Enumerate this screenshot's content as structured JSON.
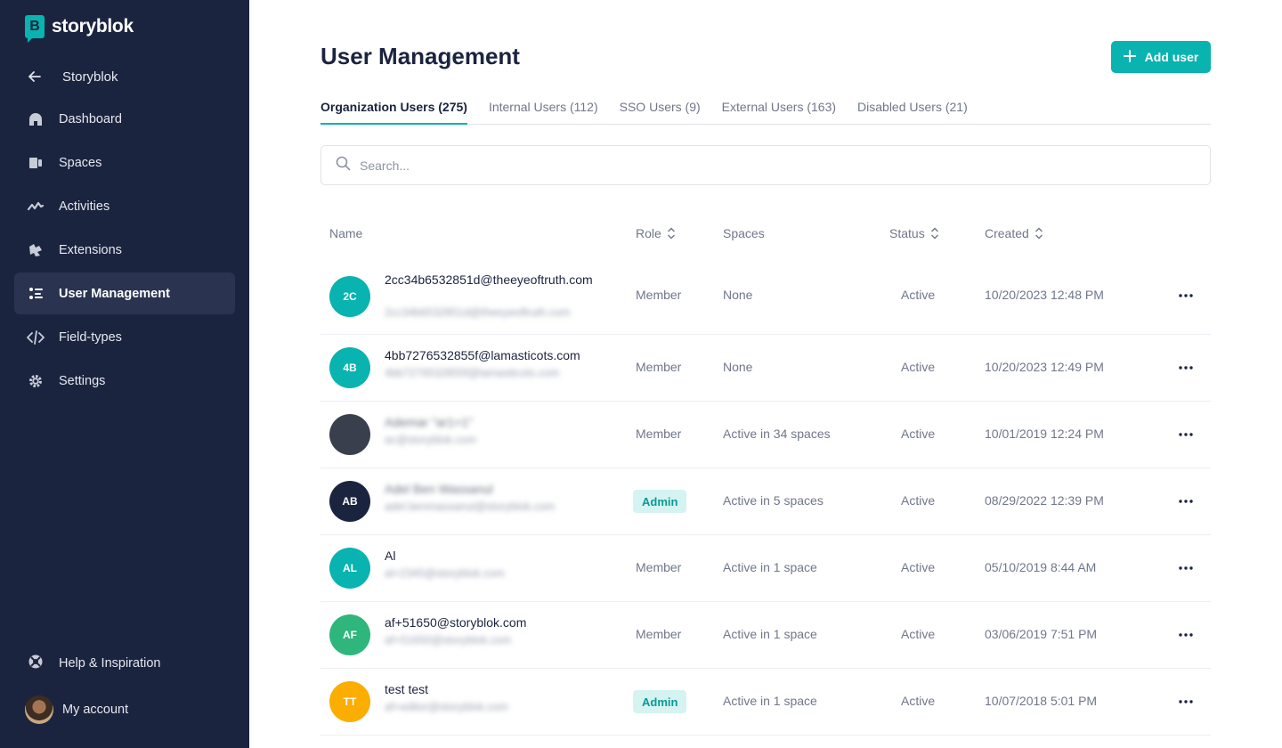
{
  "brand": {
    "name": "storyblok",
    "mark_letter": "B",
    "accent": "#09b3af",
    "sidebar_bg": "#1b243f"
  },
  "sidebar": {
    "back_label": "Storyblok",
    "items": [
      {
        "label": "Dashboard",
        "icon": "dashboard-icon"
      },
      {
        "label": "Spaces",
        "icon": "spaces-icon"
      },
      {
        "label": "Activities",
        "icon": "activities-icon"
      },
      {
        "label": "Extensions",
        "icon": "extensions-icon"
      },
      {
        "label": "User Management",
        "icon": "user-management-icon",
        "active": true
      },
      {
        "label": "Field-types",
        "icon": "code-icon"
      },
      {
        "label": "Settings",
        "icon": "gear-icon"
      }
    ],
    "help_label": "Help & Inspiration",
    "account_label": "My account"
  },
  "page": {
    "title": "User Management",
    "add_button": "Add user",
    "tabs": [
      {
        "label": "Organization Users (275)",
        "active": true
      },
      {
        "label": "Internal Users (112)"
      },
      {
        "label": "SSO Users (9)"
      },
      {
        "label": "External Users (163)"
      },
      {
        "label": "Disabled Users (21)"
      }
    ],
    "search_placeholder": "Search..."
  },
  "table": {
    "columns": {
      "name": "Name",
      "role": "Role",
      "spaces": "Spaces",
      "status": "Status",
      "created": "Created"
    },
    "rows": [
      {
        "initials": "2C",
        "avatar_color": "#09b3af",
        "name": "2cc34b6532851d@theeyeoftruth.com",
        "sub": "2cc34b6532851d@theeyeoftruth.com",
        "role": "Member",
        "spaces": "None",
        "status": "Active",
        "created": "10/20/2023 12:48 PM"
      },
      {
        "initials": "4B",
        "avatar_color": "#09b3af",
        "name": "4bb7276532855f@lamasticots.com",
        "sub": "4bb7276532855f@lamasticots.com",
        "role": "Member",
        "spaces": "None",
        "status": "Active",
        "created": "10/20/2023 12:49 PM"
      },
      {
        "initials": "",
        "avatar_color": "#3a3f4e",
        "name": "Ademar \"ar1+1\"",
        "sub": "ac@storyblok.com",
        "role": "Member",
        "spaces": "Active in 34 spaces",
        "status": "Active",
        "created": "10/01/2019 12:24 PM"
      },
      {
        "initials": "AB",
        "avatar_color": "#1b243f",
        "name": "Adel Ben Wassanul",
        "sub": "adel.benmassanul@storyblok.com",
        "role": "Admin",
        "spaces": "Active in 5 spaces",
        "status": "Active",
        "created": "08/29/2022 12:39 PM"
      },
      {
        "initials": "AL",
        "avatar_color": "#09b3af",
        "name": "Al",
        "sub": "al+2345@storyblok.com",
        "role": "Member",
        "spaces": "Active in 1 space",
        "status": "Active",
        "created": "05/10/2019 8:44 AM"
      },
      {
        "initials": "AF",
        "avatar_color": "#2fb67c",
        "name": "af+51650@storyblok.com",
        "sub": "af+51650@storyblok.com",
        "role": "Member",
        "spaces": "Active in 1 space",
        "status": "Active",
        "created": "03/06/2019 7:51 PM"
      },
      {
        "initials": "TT",
        "avatar_color": "#fbad00",
        "name": "test test",
        "sub": "af+editor@storyblok.com",
        "role": "Admin",
        "spaces": "Active in 1 space",
        "status": "Active",
        "created": "10/07/2018 5:01 PM"
      }
    ]
  }
}
